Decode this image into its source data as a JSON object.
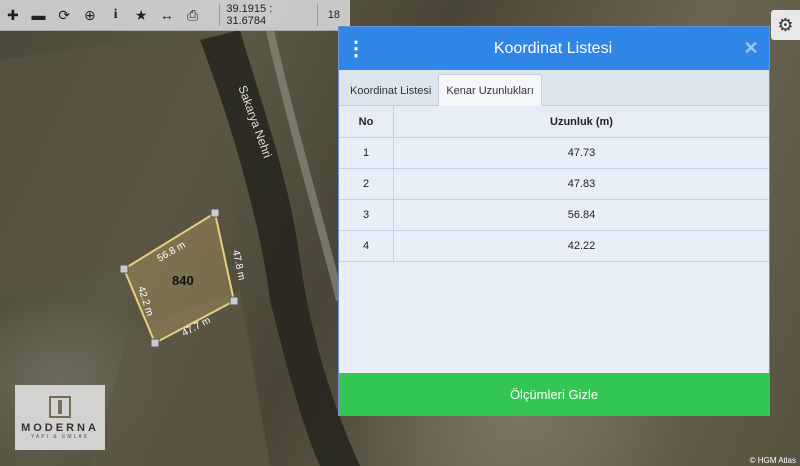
{
  "toolbar": {
    "coords": "39.1915 : 31.6784",
    "zoom": "18"
  },
  "map": {
    "river_label": "Sakarya Nehri",
    "parcel_label": "840",
    "edge_labels": [
      "56.8 m",
      "47.8 m",
      "47.7 m",
      "42.2 m"
    ],
    "attribution": "© HGM Atlas"
  },
  "dialog": {
    "title": "Koordinat Listesi",
    "tabs": [
      {
        "label": "Koordinat Listesi"
      },
      {
        "label": "Kenar Uzunlukları"
      }
    ],
    "table": {
      "headers": [
        "No",
        "Uzunluk (m)"
      ],
      "rows": [
        [
          "1",
          "47.73"
        ],
        [
          "2",
          "47.83"
        ],
        [
          "3",
          "56.84"
        ],
        [
          "4",
          "42.22"
        ]
      ]
    },
    "footer_button": "Ölçümleri Gizle"
  },
  "logo": {
    "name": "MODERNA",
    "sub": "YAPI & EMLAK"
  }
}
